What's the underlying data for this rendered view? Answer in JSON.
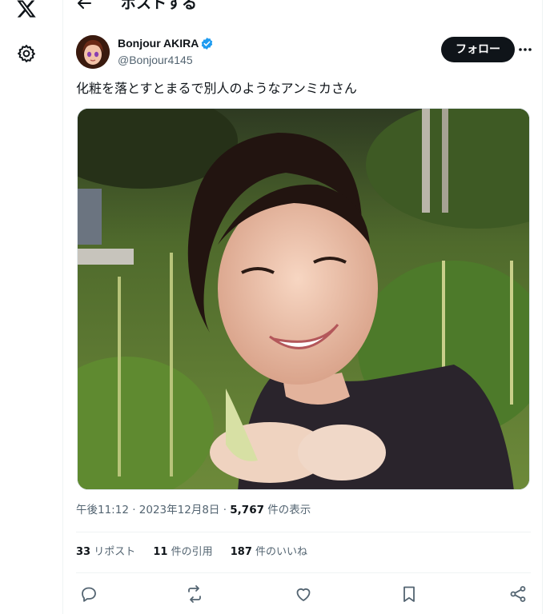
{
  "header": {
    "title": "ポストする"
  },
  "author": {
    "name": "Bonjour AKIRA",
    "handle": "@Bonjour4145",
    "follow_label": "フォロー"
  },
  "tweet": {
    "text": "化粧を落とすとまるで別人のようなアンミカさん"
  },
  "meta": {
    "time": "午後11:12",
    "sep1": " · ",
    "date": "2023年12月8日",
    "sep2": " · ",
    "views": "5,767",
    "views_label": " 件の表示"
  },
  "stats": {
    "reposts": "33",
    "reposts_label": " リポスト",
    "quotes": "11",
    "quotes_label": " 件の引用",
    "likes": "187",
    "likes_label": " 件のいいね"
  },
  "icons": {
    "logo": "x-logo-icon",
    "settings": "gear-icon",
    "back": "back-arrow-icon",
    "verified": "verified-badge-icon",
    "more": "more-icon",
    "reply": "reply-icon",
    "repost": "repost-icon",
    "like": "heart-icon",
    "bookmark": "bookmark-icon",
    "share": "share-icon"
  },
  "colors": {
    "text": "#0f1419",
    "secondary": "#536471",
    "verified": "#1d9bf0",
    "follow_bg": "#0f1419"
  }
}
